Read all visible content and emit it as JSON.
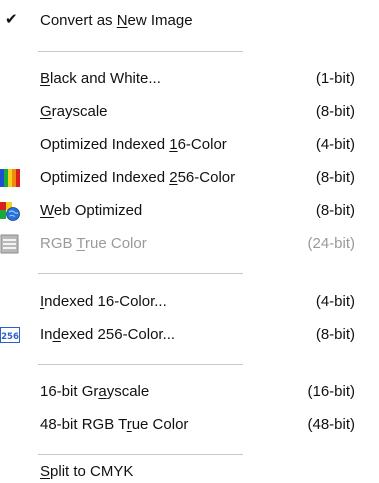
{
  "menu": {
    "items": [
      {
        "id": "convert-new",
        "pre": "Convert as ",
        "u": "N",
        "post": "ew Image",
        "bits": "",
        "checked": true
      },
      {
        "id": "black-white",
        "pre": "",
        "u": "B",
        "post": "lack and White...",
        "bits": "(1-bit)"
      },
      {
        "id": "grayscale",
        "pre": "",
        "u": "G",
        "post": "rayscale",
        "bits": "(8-bit)"
      },
      {
        "id": "opt-16",
        "pre": "Optimized Indexed ",
        "u": "1",
        "post": "6-Color",
        "bits": "(4-bit)"
      },
      {
        "id": "opt-256",
        "pre": "Optimized Indexed ",
        "u": "2",
        "post": "56-Color",
        "bits": "(8-bit)",
        "icon": "color-palette-icon"
      },
      {
        "id": "web-opt",
        "pre": "",
        "u": "W",
        "post": "eb Optimized",
        "bits": "(8-bit)",
        "icon": "web-optimized-icon"
      },
      {
        "id": "rgb-true",
        "pre": "RGB ",
        "u": "T",
        "post": "rue Color",
        "bits": "(24-bit)",
        "icon": "rgb-true-color-icon",
        "disabled": true
      },
      {
        "id": "idx-16",
        "pre": "",
        "u": "I",
        "post": "ndexed 16-Color...",
        "bits": "(4-bit)"
      },
      {
        "id": "idx-256",
        "pre": "In",
        "u": "d",
        "post": "exed 256-Color...",
        "bits": "(8-bit)",
        "icon": "indexed-256-icon",
        "icon_text": "256"
      },
      {
        "id": "gray-16",
        "pre": "16-bit Gr",
        "u": "a",
        "post": "yscale",
        "bits": "(16-bit)"
      },
      {
        "id": "rgb-48",
        "pre": "48-bit RGB T",
        "u": "r",
        "post": "ue Color",
        "bits": "(48-bit)"
      },
      {
        "id": "split-cmyk",
        "pre": "",
        "u": "S",
        "post": "plit to CMYK",
        "bits": ""
      }
    ],
    "check_glyph": "✔"
  }
}
